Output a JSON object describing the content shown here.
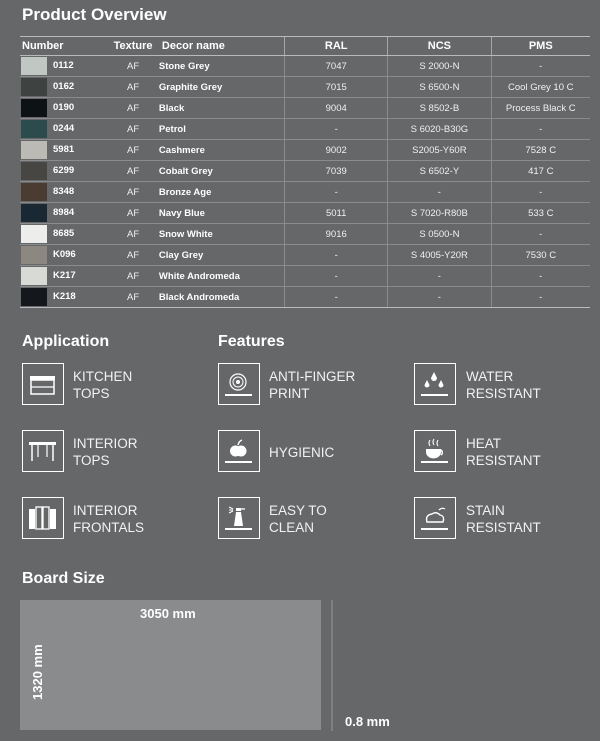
{
  "title": "Product Overview",
  "table": {
    "headers": [
      "Number",
      "Texture",
      "Decor name",
      "RAL",
      "NCS",
      "PMS"
    ],
    "rows": [
      {
        "swatch": "#c1c8c4",
        "number": "0112",
        "texture": "AF",
        "decor": "Stone Grey",
        "ral": "7047",
        "ncs": "S 2000-N",
        "pms": "-"
      },
      {
        "swatch": "#3e4241",
        "number": "0162",
        "texture": "AF",
        "decor": "Graphite Grey",
        "ral": "7015",
        "ncs": "S 6500-N",
        "pms": "Cool Grey 10 C"
      },
      {
        "swatch": "#0d1214",
        "number": "0190",
        "texture": "AF",
        "decor": "Black",
        "ral": "9004",
        "ncs": "S 8502-B",
        "pms": "Process Black C"
      },
      {
        "swatch": "#2c4b4d",
        "number": "0244",
        "texture": "AF",
        "decor": "Petrol",
        "ral": "-",
        "ncs": "S 6020-B30G",
        "pms": "-"
      },
      {
        "swatch": "#bcbab5",
        "number": "5981",
        "texture": "AF",
        "decor": "Cashmere",
        "ral": "9002",
        "ncs": "S2005-Y60R",
        "pms": "7528 C"
      },
      {
        "swatch": "#474643",
        "number": "6299",
        "texture": "AF",
        "decor": "Cobalt Grey",
        "ral": "7039",
        "ncs": "S 6502-Y",
        "pms": "417 C"
      },
      {
        "swatch": "#4a3c30",
        "number": "8348",
        "texture": "AF",
        "decor": "Bronze Age",
        "ral": "-",
        "ncs": "-",
        "pms": "-"
      },
      {
        "swatch": "#1a2833",
        "number": "8984",
        "texture": "AF",
        "decor": "Navy Blue",
        "ral": "5011",
        "ncs": "S 7020-R80B",
        "pms": "533 C"
      },
      {
        "swatch": "#ededeb",
        "number": "8685",
        "texture": "AF",
        "decor": "Snow White",
        "ral": "9016",
        "ncs": "S 0500-N",
        "pms": "-"
      },
      {
        "swatch": "#8c8780",
        "number": "K096",
        "texture": "AF",
        "decor": "Clay Grey",
        "ral": "-",
        "ncs": "S 4005-Y20R",
        "pms": "7530 C"
      },
      {
        "swatch": "#d7dad5",
        "number": "K217",
        "texture": "AF",
        "decor": "White Andromeda",
        "ral": "-",
        "ncs": "-",
        "pms": "-"
      },
      {
        "swatch": "#14171b",
        "number": "K218",
        "texture": "AF",
        "decor": "Black Andromeda",
        "ral": "-",
        "ncs": "-",
        "pms": "-"
      }
    ]
  },
  "application": {
    "heading": "Application",
    "items": [
      {
        "icon": "kitchen-tops-icon",
        "line1": "KITCHEN",
        "line2": "TOPS"
      },
      {
        "icon": "interior-tops-icon",
        "line1": "INTERIOR",
        "line2": "TOPS"
      },
      {
        "icon": "interior-frontals-icon",
        "line1": "INTERIOR",
        "line2": "FRONTALS"
      }
    ]
  },
  "features": {
    "heading": "Features",
    "items": [
      {
        "icon": "fingerprint-icon",
        "line1": "ANTI-FINGER",
        "line2": "PRINT"
      },
      {
        "icon": "water-drops-icon",
        "line1": "WATER",
        "line2": "RESISTANT"
      },
      {
        "icon": "apple-icon",
        "line1": "HYGIENIC",
        "line2": ""
      },
      {
        "icon": "hot-cup-icon",
        "line1": "HEAT",
        "line2": "RESISTANT"
      },
      {
        "icon": "spray-bottle-icon",
        "line1": "EASY TO",
        "line2": "CLEAN"
      },
      {
        "icon": "stain-icon",
        "line1": "STAIN",
        "line2": "RESISTANT"
      }
    ]
  },
  "board": {
    "heading": "Board Size",
    "width_label": "3050 mm",
    "height_label": "1320 mm",
    "thickness_label": "0.8 mm"
  }
}
